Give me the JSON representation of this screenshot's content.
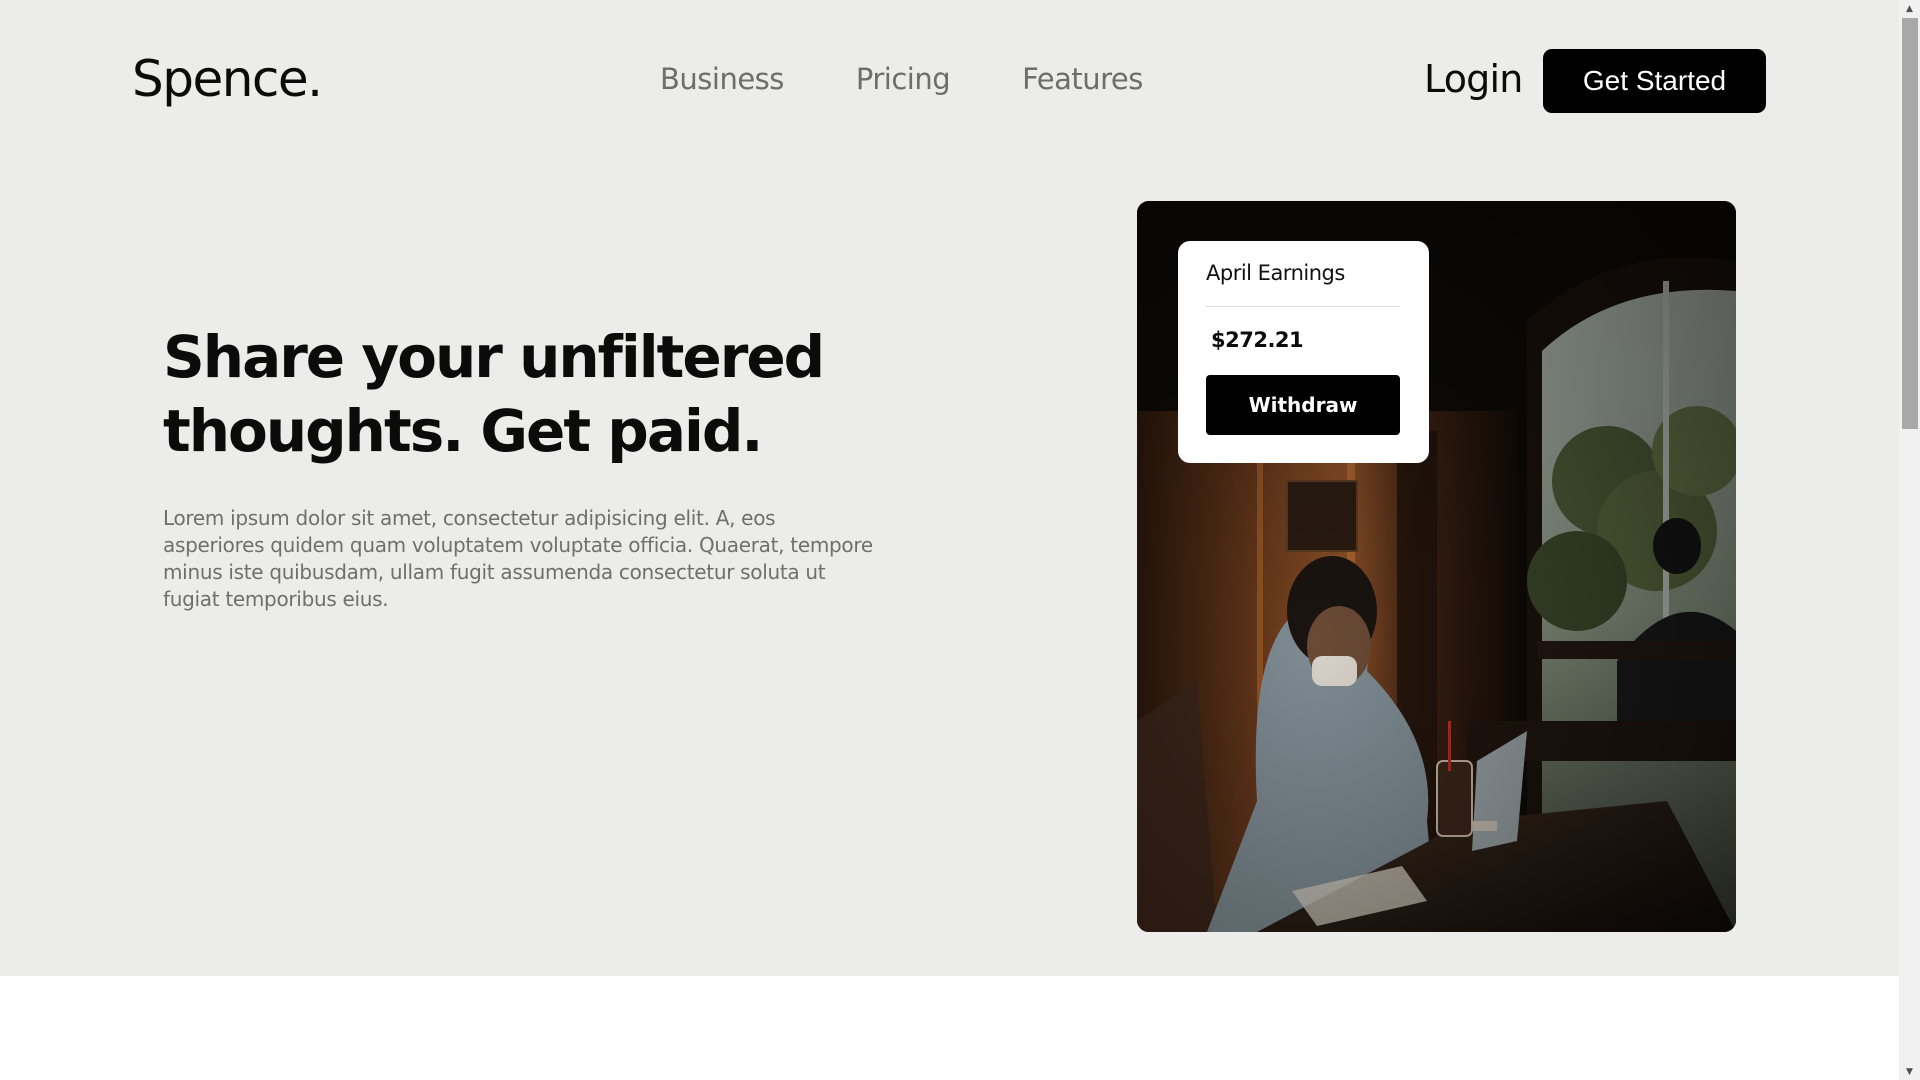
{
  "brand": {
    "logo": "Spence."
  },
  "nav": {
    "items": [
      {
        "label": "Business"
      },
      {
        "label": "Pricing"
      },
      {
        "label": "Features"
      }
    ],
    "login_label": "Login",
    "cta_label": "Get Started"
  },
  "hero": {
    "headline": "Share your unfiltered thoughts. Get paid.",
    "body": "Lorem ipsum dolor sit amet, consectetur adipisicing elit. A, eos asperiores quidem quam voluptatem voluptate officia. Quaerat, tempore minus iste quibusdam, ullam fugit assumenda consectetur soluta ut fugiat temporibus eius."
  },
  "earnings_card": {
    "title": "April Earnings",
    "amount": "$272.21",
    "withdraw_label": "Withdraw"
  },
  "colors": {
    "hero_background": "#ececea",
    "primary": "#000000",
    "text_dark": "#0b0b0b",
    "text_muted": "#6d6d6d"
  },
  "icons": {
    "scroll_up": "scroll-up-arrow-icon",
    "scroll_down": "scroll-down-arrow-icon"
  }
}
